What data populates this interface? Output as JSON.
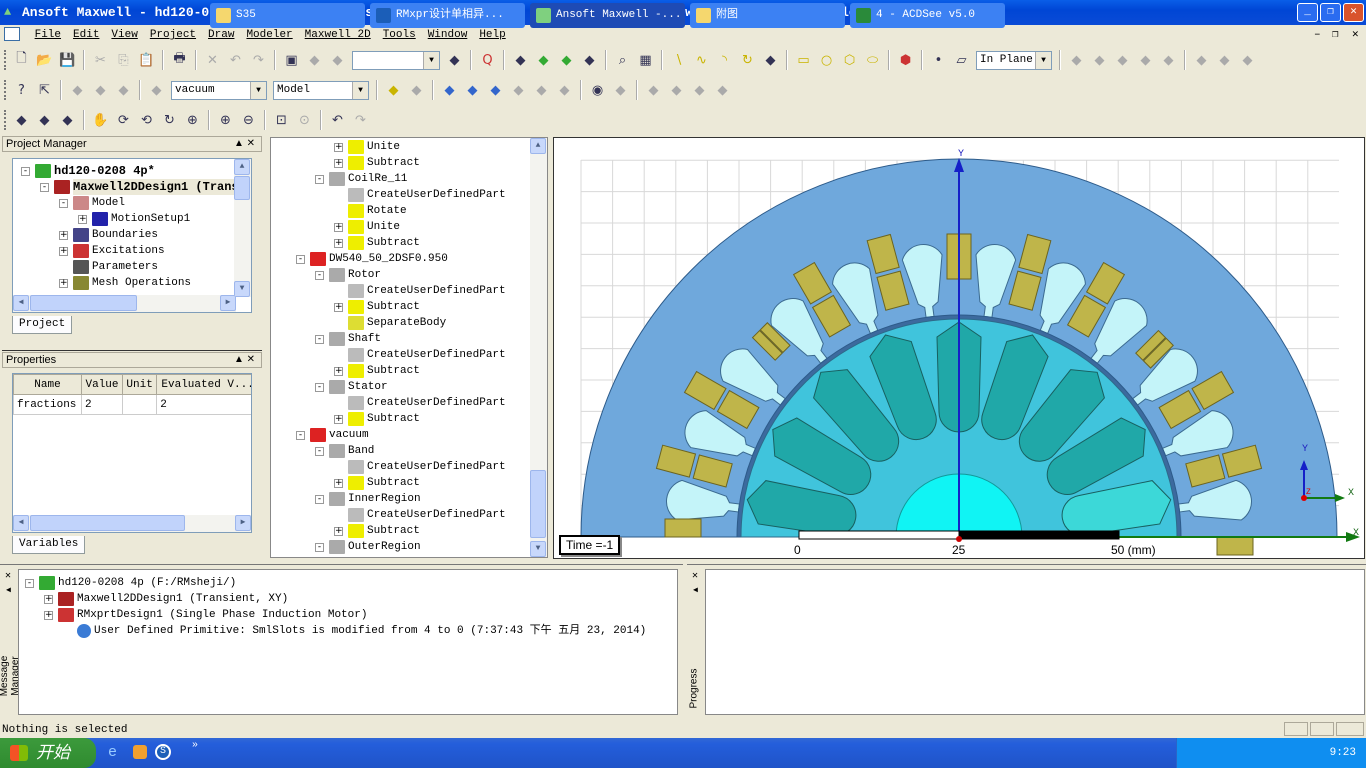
{
  "window": {
    "title": "Ansoft Maxwell - hd120-0208 4p - Maxwell2DDesign1 - 3D Modeler - [hd120-0208 4p - Maxwell2DDesign1 - Modeler]",
    "min": "_",
    "restore": "❐",
    "close": "✕",
    "child_min": "–",
    "child_restore": "❐",
    "child_close": "✕"
  },
  "menu": [
    "File",
    "Edit",
    "View",
    "Project",
    "Draw",
    "Modeler",
    "Maxwell 2D",
    "Tools",
    "Window",
    "Help"
  ],
  "toolbar": {
    "row1": [
      "new-file",
      "open-folder",
      "save",
      "|",
      "cut",
      "copy",
      "paste",
      "|",
      "print",
      "|",
      "delete",
      "undo",
      "redo",
      "|",
      "select-mode",
      "select-1",
      "select-2",
      "COMBO0",
      "hierarchy",
      "|",
      "q-report",
      "|",
      "validate-list",
      "validate-check",
      "analyze",
      "report",
      "|",
      "find",
      "grid",
      "|",
      "line",
      "spline",
      "arc",
      "arc-center",
      "polyline",
      "|",
      "rectangle",
      "circle",
      "polygon",
      "ellipse",
      "|",
      "box-3d",
      "|",
      "point",
      "plane",
      "PLANE",
      "|",
      "unite",
      "subtract",
      "intersect",
      "split",
      "separate",
      "|",
      "mirror",
      "sweep",
      "align"
    ],
    "row2": [
      "help-context",
      "whats-this",
      "|",
      "align-a",
      "align-b",
      "mirror-b",
      "|",
      "material",
      "MAT",
      "PART",
      "|",
      "coord-sys",
      "coord-sys-2",
      "|",
      "move",
      "rotate",
      "scale",
      "offset",
      "face",
      "edge",
      "|",
      "visibility",
      "shade",
      "|",
      "view-a",
      "view-b",
      "view-c",
      "view-d"
    ],
    "row3": [
      "tool-a",
      "tool-b",
      "tool-c",
      "|",
      "pan",
      "rotate-view",
      "rotate-axis",
      "spin",
      "zoom-dynamic",
      "|",
      "zoom-in",
      "zoom-out",
      "|",
      "fit-all",
      "fit-selected",
      "|",
      "undo-view",
      "redo-view"
    ],
    "combo_row1": "",
    "material": "vacuum",
    "part_view": "Model",
    "plane": "In Plane"
  },
  "project_manager": {
    "title": "Project Manager",
    "tab": "Project",
    "items": [
      {
        "label": "hd120-0208 4p*",
        "level": 0,
        "exp": "−",
        "bold": true,
        "icon": "project-icon"
      },
      {
        "label": "Maxwell2DDesign1 (Trans",
        "level": 1,
        "exp": "−",
        "bold": true,
        "icon": "design-icon"
      },
      {
        "label": "Model",
        "level": 2,
        "exp": "−",
        "icon": "model-icon"
      },
      {
        "label": "MotionSetup1",
        "level": 3,
        "exp": "+",
        "icon": "motion-icon"
      },
      {
        "label": "Boundaries",
        "level": 2,
        "exp": "+",
        "icon": "boundaries-icon"
      },
      {
        "label": "Excitations",
        "level": 2,
        "exp": "+",
        "icon": "excitations-icon"
      },
      {
        "label": "Parameters",
        "level": 2,
        "exp": "",
        "icon": "parameters-icon"
      },
      {
        "label": "Mesh Operations",
        "level": 2,
        "exp": "+",
        "icon": "mesh-icon"
      }
    ]
  },
  "properties": {
    "title": "Properties",
    "tab": "Variables",
    "columns": [
      "Name",
      "Value",
      "Unit",
      "Evaluated V...",
      ""
    ],
    "rows": [
      [
        "fractions",
        "2",
        "",
        "2",
        "I"
      ]
    ]
  },
  "model_tree": {
    "items": [
      {
        "label": "Unite",
        "level": 3,
        "exp": "+",
        "icon": "unite-icon"
      },
      {
        "label": "Subtract",
        "level": 3,
        "exp": "+",
        "icon": "subtract-icon"
      },
      {
        "label": "CoilRe_11",
        "level": 2,
        "exp": "−",
        "icon": "object-icon"
      },
      {
        "label": "CreateUserDefinedPart",
        "level": 3,
        "exp": "",
        "icon": "udp-icon"
      },
      {
        "label": "Rotate",
        "level": 3,
        "exp": "",
        "icon": "rotate-icon"
      },
      {
        "label": "Unite",
        "level": 3,
        "exp": "+",
        "icon": "unite-icon"
      },
      {
        "label": "Subtract",
        "level": 3,
        "exp": "+",
        "icon": "subtract-icon"
      },
      {
        "label": "DW540_50_2DSF0.950",
        "level": 1,
        "exp": "−",
        "icon": "material-icon"
      },
      {
        "label": "Rotor",
        "level": 2,
        "exp": "−",
        "icon": "object-icon"
      },
      {
        "label": "CreateUserDefinedPart",
        "level": 3,
        "exp": "",
        "icon": "udp-icon"
      },
      {
        "label": "Subtract",
        "level": 3,
        "exp": "+",
        "icon": "subtract-icon"
      },
      {
        "label": "SeparateBody",
        "level": 3,
        "exp": "",
        "icon": "separate-icon"
      },
      {
        "label": "Shaft",
        "level": 2,
        "exp": "−",
        "icon": "object-icon"
      },
      {
        "label": "CreateUserDefinedPart",
        "level": 3,
        "exp": "",
        "icon": "udp-icon"
      },
      {
        "label": "Subtract",
        "level": 3,
        "exp": "+",
        "icon": "subtract-icon"
      },
      {
        "label": "Stator",
        "level": 2,
        "exp": "−",
        "icon": "object-icon"
      },
      {
        "label": "CreateUserDefinedPart",
        "level": 3,
        "exp": "",
        "icon": "udp-icon"
      },
      {
        "label": "Subtract",
        "level": 3,
        "exp": "+",
        "icon": "subtract-icon"
      },
      {
        "label": "vacuum",
        "level": 1,
        "exp": "−",
        "icon": "material-icon"
      },
      {
        "label": "Band",
        "level": 2,
        "exp": "−",
        "icon": "object-icon"
      },
      {
        "label": "CreateUserDefinedPart",
        "level": 3,
        "exp": "",
        "icon": "udp-icon"
      },
      {
        "label": "Subtract",
        "level": 3,
        "exp": "+",
        "icon": "subtract-icon"
      },
      {
        "label": "InnerRegion",
        "level": 2,
        "exp": "−",
        "icon": "object-icon"
      },
      {
        "label": "CreateUserDefinedPart",
        "level": 3,
        "exp": "",
        "icon": "udp-icon"
      },
      {
        "label": "Subtract",
        "level": 3,
        "exp": "+",
        "icon": "subtract-icon"
      },
      {
        "label": "OuterRegion",
        "level": 2,
        "exp": "−",
        "icon": "object-icon"
      }
    ]
  },
  "modeler": {
    "time_label": "Time =-1",
    "axis_y": "Y",
    "axis_x": "X",
    "triad_y": "Y",
    "triad_x": "X",
    "triad_z": "Z",
    "scale_labels": [
      "0",
      "25",
      "50 (mm)"
    ],
    "colors": {
      "stator": "#6fa8dc",
      "slot": "#c4f4f9",
      "coil": "#bfb54a",
      "rotor": "#40c4dc",
      "bar": "#20a8a8",
      "bar_alt": "#3cd8d8",
      "shaft": "#10f4f4",
      "band": "#3c6a9e",
      "grid": "#d8d8d8"
    },
    "stator_slots": 24,
    "rotor_bars": 18
  },
  "messages": {
    "title": "Message Manager",
    "items": [
      {
        "label": "hd120-0208 4p (F:/RMsheji/)",
        "level": 0,
        "exp": "−",
        "icon": "project-icon"
      },
      {
        "label": "Maxwell2DDesign1 (Transient, XY)",
        "level": 1,
        "exp": "+",
        "icon": "design-icon"
      },
      {
        "label": "RMxprtDesign1 (Single Phase Induction Motor)",
        "level": 1,
        "exp": "+",
        "icon": "rmxprt-icon"
      },
      {
        "label": "User Defined Primitive: SmlSlots is modified from 4 to 0 (7:37:43 下午  五月 23, 2014)",
        "level": 2,
        "exp": "",
        "icon": "info-icon"
      }
    ]
  },
  "progress": {
    "title": "Progress"
  },
  "status": {
    "text": "Nothing is selected"
  },
  "taskbar": {
    "start": "开始",
    "quicklaunch_more": "»",
    "buttons": [
      "S35",
      "RMxpr设计单相异...",
      "Ansoft Maxwell -...",
      "附图",
      "4 - ACDSee v5.0"
    ],
    "active": 2,
    "clock": "9:23"
  }
}
